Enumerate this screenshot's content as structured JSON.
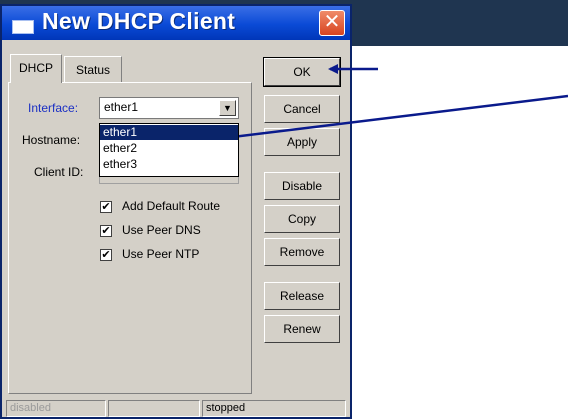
{
  "window": {
    "title": "New DHCP Client",
    "close_glyph": "✕"
  },
  "tabs": [
    {
      "label": "DHCP",
      "active": true
    },
    {
      "label": "Status",
      "active": false
    }
  ],
  "form": {
    "interface_label": "Interface:",
    "interface_value": "ether1",
    "hostname_label": "Hostname:",
    "client_id_label": "Client ID:",
    "dropdown_options": [
      "ether1",
      "ether2",
      "ether3"
    ],
    "selected_option": "ether1",
    "checkboxes": [
      {
        "label": "Add Default Route",
        "checked": true
      },
      {
        "label": "Use Peer DNS",
        "checked": true
      },
      {
        "label": "Use Peer NTP",
        "checked": true
      }
    ]
  },
  "buttons": {
    "ok": "OK",
    "cancel": "Cancel",
    "apply": "Apply",
    "disable": "Disable",
    "copy": "Copy",
    "remove": "Remove",
    "release": "Release",
    "renew": "Renew"
  },
  "statusbar": {
    "left": "disabled",
    "middle": "",
    "right": "stopped"
  },
  "icons": {
    "window": "window-icon",
    "close": "close-icon",
    "dropdown": "chevron-down-icon",
    "check": "✔"
  },
  "colors": {
    "titlebar": "#0a4ad6",
    "dialog_bg": "#d4d0c8",
    "label_blue": "#1a2fc4",
    "arrow": "#0a1a8c",
    "selection": "#0a246a"
  }
}
